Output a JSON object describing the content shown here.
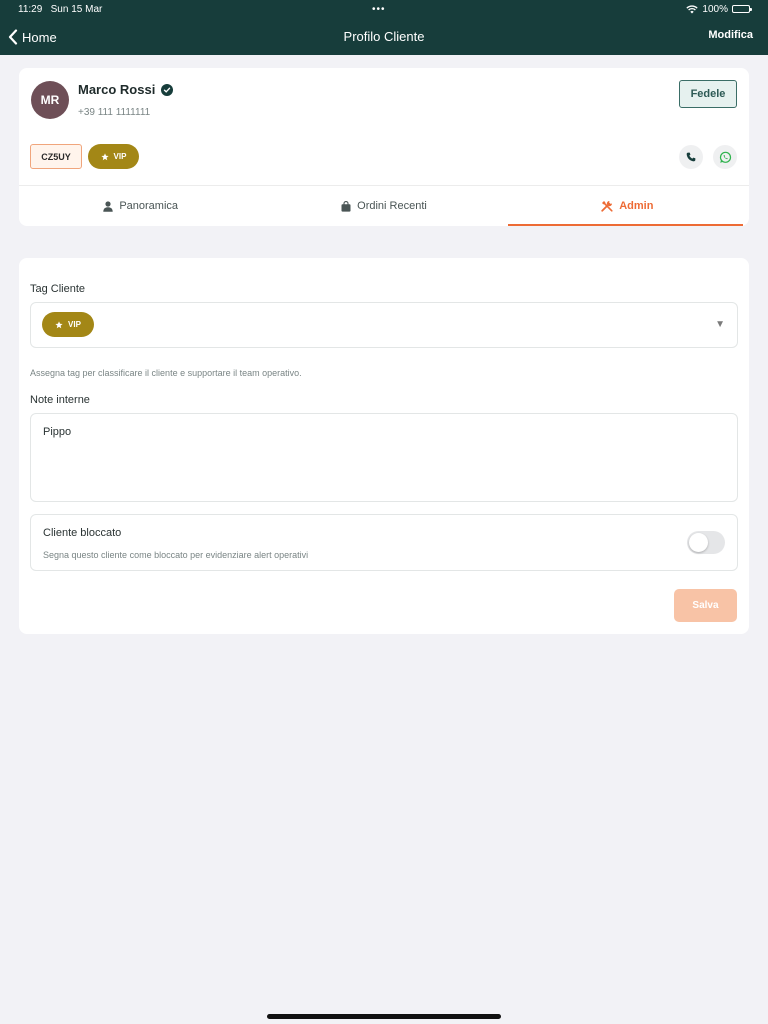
{
  "status_bar": {
    "time": "11:29",
    "date": "Sun 15 Mar",
    "dots": "•••",
    "battery": "100%"
  },
  "nav": {
    "back_label": "Home",
    "title": "Profilo Cliente",
    "action_label": "Modifica"
  },
  "customer": {
    "initials": "MR",
    "name": "Marco Rossi",
    "phone": "+39 111 1111111",
    "status": "Fedele",
    "code": "CZ5UY",
    "tag": "VIP"
  },
  "tabs": [
    {
      "label": "Panoramica",
      "icon": "person-icon"
    },
    {
      "label": "Ordini Recenti",
      "icon": "bag-icon"
    },
    {
      "label": "Admin",
      "icon": "tools-icon"
    }
  ],
  "admin": {
    "tag_label": "Tag Cliente",
    "selected_tag": "VIP",
    "hint": "Assegna tag per classificare il cliente e supportare il team operativo.",
    "notes_label": "Note interne",
    "notes_value": "Pippo",
    "blocked_title": "Cliente bloccato",
    "blocked_desc": "Segna questo cliente come bloccato per evidenziare alert operativi",
    "save_label": "Salva"
  },
  "colors": {
    "header": "#173d3b",
    "accent": "#ed6b35",
    "vip": "#a38716",
    "avatar": "#6e4f57",
    "save_disabled": "#f8c3a6"
  }
}
